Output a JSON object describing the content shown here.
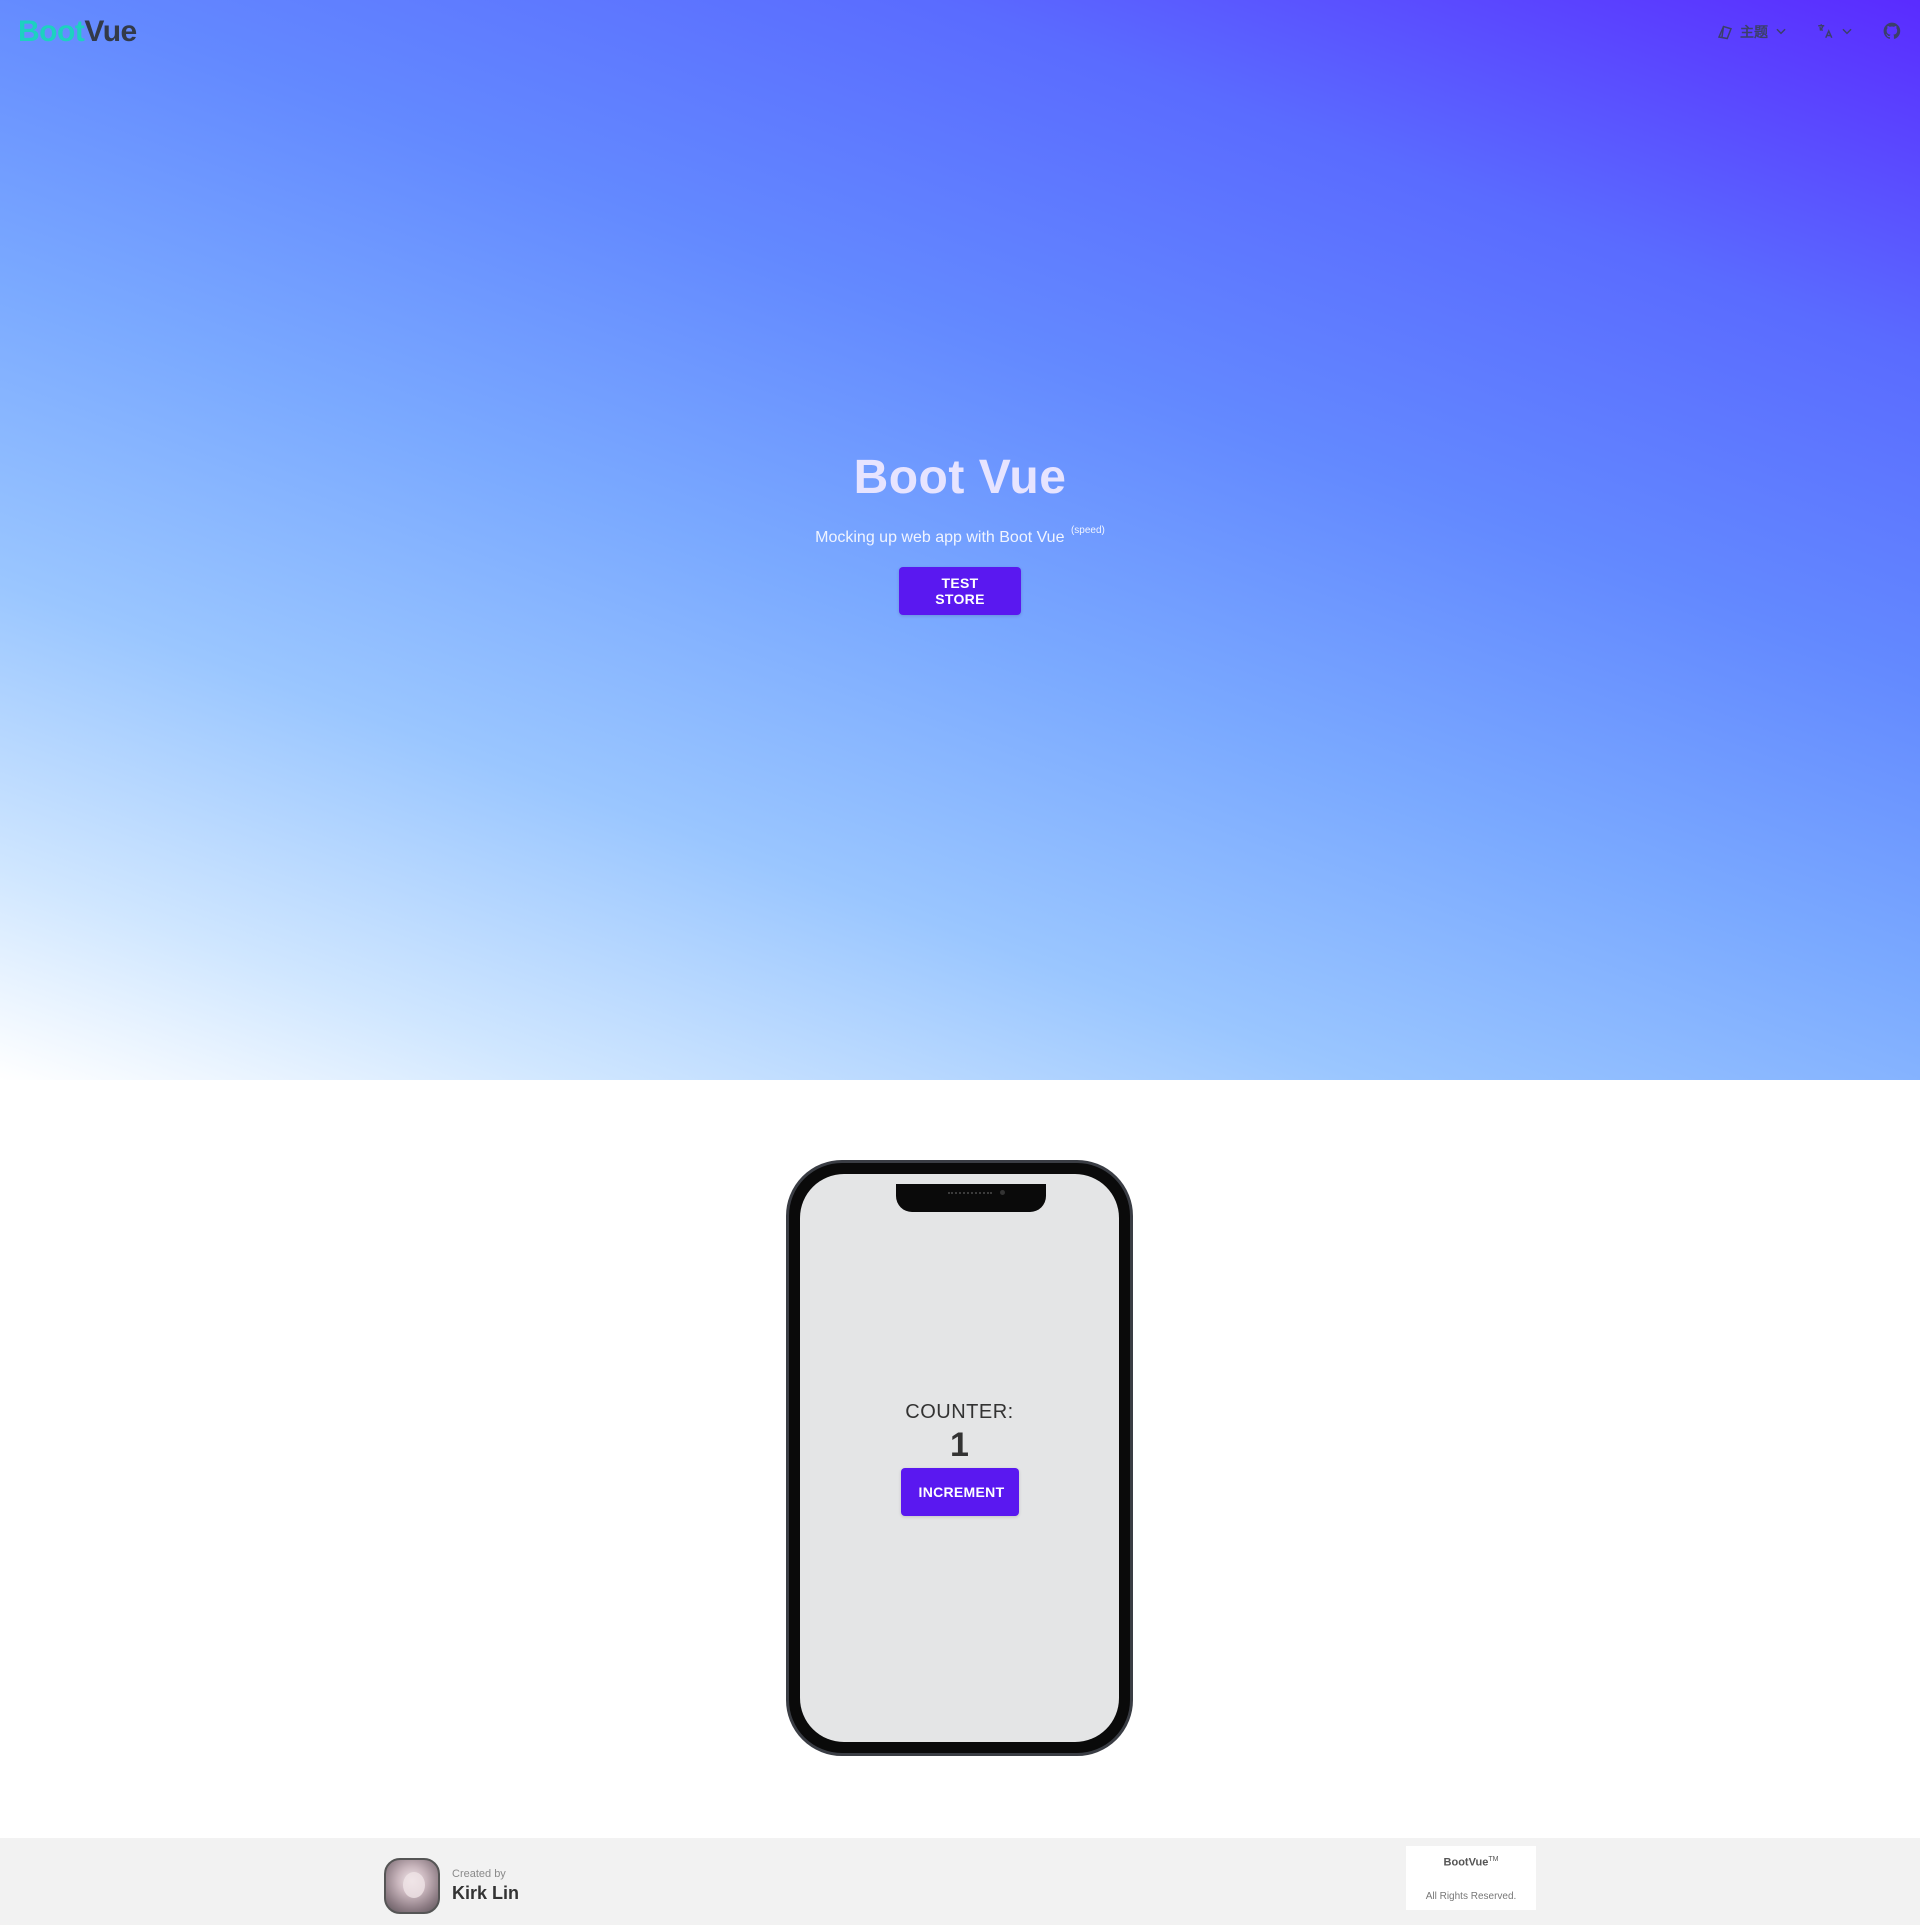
{
  "navbar": {
    "brand_part1": "Boot",
    "brand_part2": "Vue",
    "theme_label": "主题",
    "language_icon": "translate-icon",
    "github_icon": "github-icon"
  },
  "hero": {
    "title": "Boot Vue",
    "subtitle": "Mocking up web app with Boot Vue",
    "subtitle_sup": "(speed)",
    "button_label": "TEST STORE"
  },
  "phone": {
    "counter_label": "COUNTER:",
    "counter_value": "1",
    "button_label": "INCREMENT"
  },
  "footer": {
    "created_by": "Created by",
    "author_name": "Kirk Lin",
    "copyright_brand": "BootVue",
    "copyright_tm": "TM",
    "copyright_rights": "All Rights Reserved."
  },
  "colors": {
    "primary": "#5a18f0",
    "brand_teal": "#1dd1c0",
    "brand_dark": "#333a48",
    "gradient_end": "#5a2bff"
  }
}
